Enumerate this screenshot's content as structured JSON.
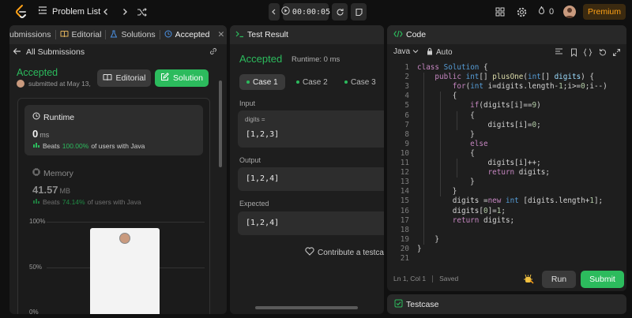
{
  "topbar": {
    "problem_list": "Problem List",
    "timer": "00:00:05",
    "streak_count": "0",
    "premium": "Premium"
  },
  "left_panel": {
    "tabs": {
      "submissions": "Submissions",
      "editorial": "Editorial",
      "solutions": "Solutions",
      "accepted": "Accepted"
    },
    "all_submissions": "All Submissions",
    "status": "Accepted",
    "submitted": "submitted at May 13,",
    "editorial_button": "Editorial",
    "solution_button": "Solution",
    "runtime": {
      "title": "Runtime",
      "value": "0",
      "unit": "ms",
      "beats_prefix": "Beats",
      "beats_value": "100.00%",
      "beats_suffix": "of users with Java"
    },
    "memory": {
      "title": "Memory",
      "value": "41.57",
      "unit": "MB",
      "beats_prefix": "Beats",
      "beats_value": "74.14%",
      "beats_suffix": "of users with Java"
    },
    "chart_labels": {
      "p100": "100%",
      "p50": "50%",
      "p0": "0%"
    }
  },
  "mid_panel": {
    "title": "Test Result",
    "status": "Accepted",
    "runtime": "Runtime: 0 ms",
    "cases": [
      "Case 1",
      "Case 2",
      "Case 3"
    ],
    "input_label": "Input",
    "input_var": "digits =",
    "input_value": "[1,2,3]",
    "output_label": "Output",
    "output_value": "[1,2,4]",
    "expected_label": "Expected",
    "expected_value": "[1,2,4]",
    "contribute": "Contribute a testcase"
  },
  "code_panel": {
    "title": "Code",
    "language": "Java",
    "auto": "Auto",
    "status_position": "Ln 1, Col 1",
    "status_saved": "Saved",
    "run": "Run",
    "submit": "Submit"
  },
  "testcase_panel": {
    "title": "Testcase"
  },
  "colors": {
    "accent_green": "#2cbb5d",
    "premium_orange": "#ffa116",
    "keyword": "#c586c0",
    "type": "#569cd6"
  }
}
